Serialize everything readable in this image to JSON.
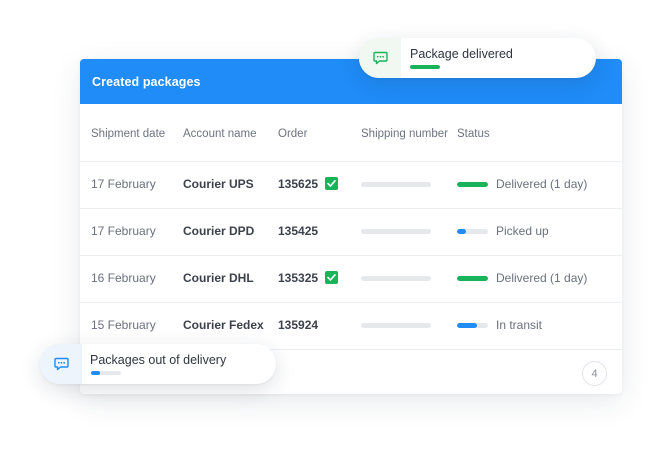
{
  "card": {
    "title": "Created packages"
  },
  "columns": {
    "shipment_date": "Shipment date",
    "account_name": "Account name",
    "order": "Order",
    "shipping_number": "Shipping number",
    "status": "Status"
  },
  "rows": [
    {
      "date": "17 February",
      "account": "Courier UPS",
      "order": "135625",
      "checked": true,
      "status": "Delivered (1 day)",
      "progress": 1.0,
      "color": "#19b35a"
    },
    {
      "date": "17 February",
      "account": "Courier DPD",
      "order": "135425",
      "checked": false,
      "status": "Picked up",
      "progress": 0.3,
      "color": "#1f8cf7"
    },
    {
      "date": "16 February",
      "account": "Courier DHL",
      "order": "135325",
      "checked": true,
      "status": "Delivered (1 day)",
      "progress": 1.0,
      "color": "#19b35a"
    },
    {
      "date": "15 February",
      "account": "Courier Fedex",
      "order": "135924",
      "checked": false,
      "status": "In transit",
      "progress": 0.65,
      "color": "#1f8cf7"
    }
  ],
  "pagination": {
    "page": "4"
  },
  "notifications": {
    "delivered": {
      "text": "Package delivered",
      "icon": "chat-icon",
      "progress": 1.0,
      "color": "#19b35a"
    },
    "out": {
      "text": "Packages out of delivery",
      "icon": "chat-icon",
      "progress": 0.3,
      "color": "#1f8cf7"
    }
  },
  "colors": {
    "accent": "#1f8cf7",
    "success": "#19b35a"
  }
}
